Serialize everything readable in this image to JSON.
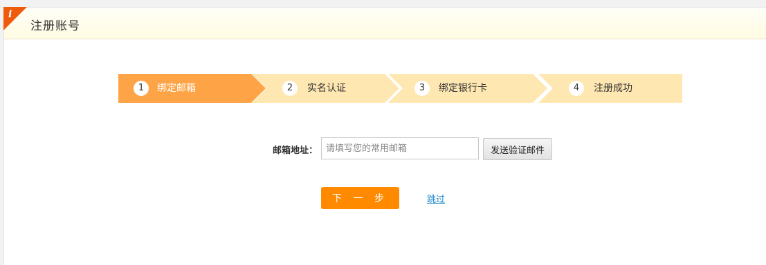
{
  "header": {
    "title": "注册账号",
    "badge_glyph": "i"
  },
  "steps": [
    {
      "number": "1",
      "label": "绑定邮箱",
      "active": true
    },
    {
      "number": "2",
      "label": "实名认证",
      "active": false
    },
    {
      "number": "3",
      "label": "绑定银行卡",
      "active": false
    },
    {
      "number": "4",
      "label": "注册成功",
      "active": false
    }
  ],
  "form": {
    "email_label": "邮箱地址：",
    "email_placeholder": "请填写您的常用邮箱",
    "email_value": "",
    "send_button_label": "发送验证邮件",
    "next_button_label": "下 一 步",
    "skip_link_label": "跳过"
  },
  "colors": {
    "active_step": "#ffa446",
    "inactive_step": "#ffe7b2",
    "primary_button": "#ff8a00",
    "link": "#1a88c9",
    "corner_badge": "#ef5b0c"
  }
}
